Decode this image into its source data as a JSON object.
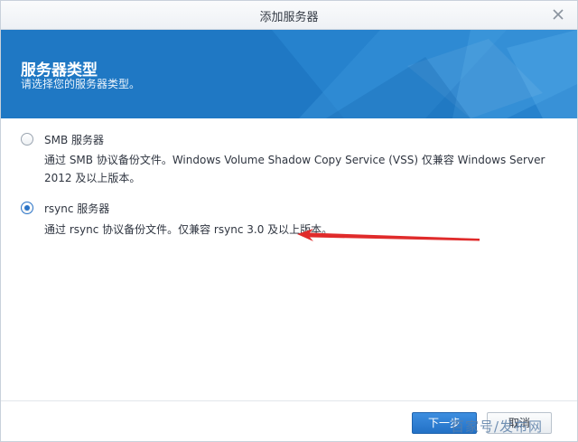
{
  "dialog": {
    "title": "添加服务器",
    "close_icon": "close-icon"
  },
  "banner": {
    "heading": "服务器类型",
    "subheading": "请选择您的服务器类型。",
    "accent_color": "#1f78c4"
  },
  "options": [
    {
      "label": "SMB 服务器",
      "description": "通过 SMB 协议备份文件。Windows Volume Shadow Copy Service (VSS) 仅兼容 Windows Server 2012 及以上版本。",
      "selected": false
    },
    {
      "label": "rsync 服务器",
      "description": "通过 rsync 协议备份文件。仅兼容 rsync 3.0 及以上版本。",
      "selected": true
    }
  ],
  "footer": {
    "next_label": "下一步",
    "cancel_label": "取消"
  },
  "watermark": {
    "text": "百家号/发布网"
  },
  "annotation": {
    "arrow_color": "#e02b2b"
  }
}
